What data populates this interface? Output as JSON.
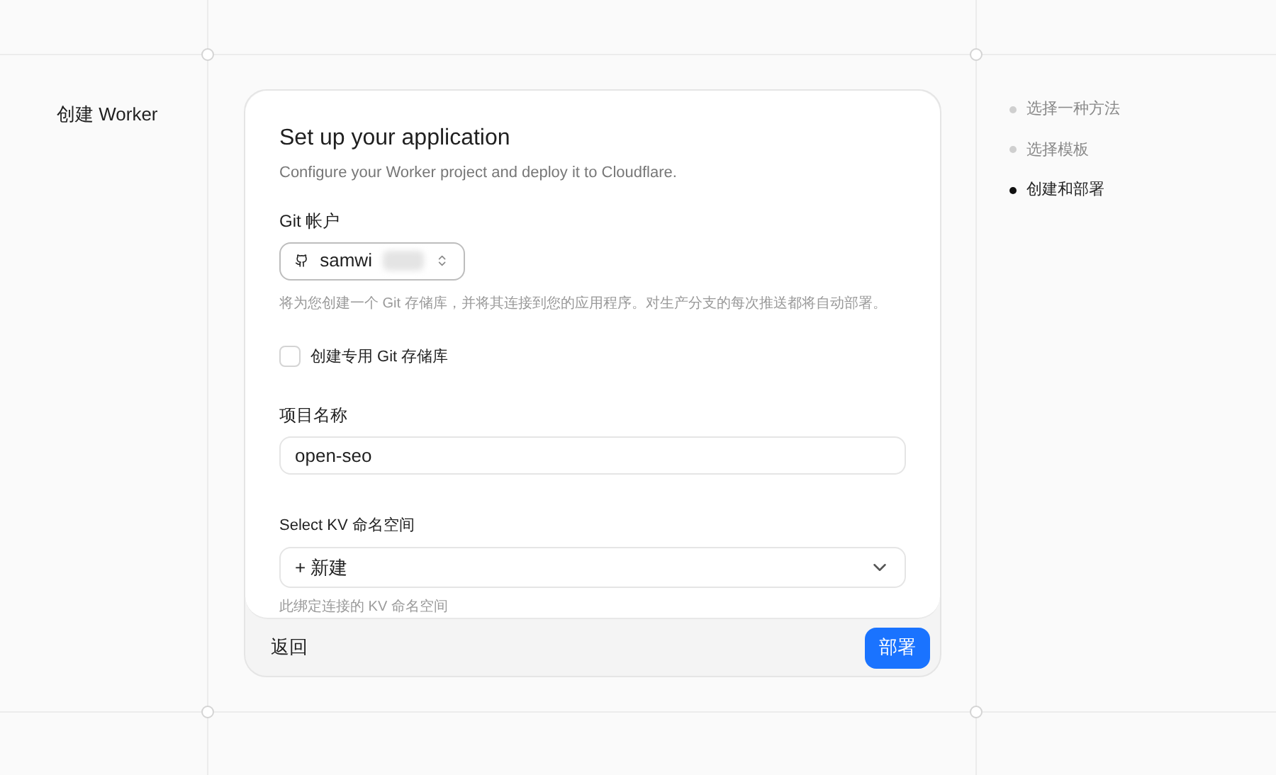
{
  "page_title": "创建 Worker",
  "steps": [
    {
      "label": "选择一种方法",
      "selected": false
    },
    {
      "label": "选择模板",
      "selected": false
    },
    {
      "label": "创建和部署",
      "selected": true
    }
  ],
  "card": {
    "title": "Set up your application",
    "subtitle": "Configure your Worker project and deploy it to Cloudflare.",
    "git_account": {
      "label": "Git 帐户",
      "value": "samwi",
      "hint": "将为您创建一个 Git 存储库，并将其连接到您的应用程序。对生产分支的每次推送都将自动部署。"
    },
    "private_repo": {
      "label": "创建专用 Git 存储库",
      "checked": false
    },
    "project_name": {
      "label": "项目名称",
      "value": "open-seo"
    },
    "kv_namespace": {
      "label": "Select KV 命名空间",
      "value": "+ 新建",
      "hint": "此绑定连接的 KV 命名空间"
    },
    "back_button": "返回",
    "deploy_button": "部署"
  }
}
